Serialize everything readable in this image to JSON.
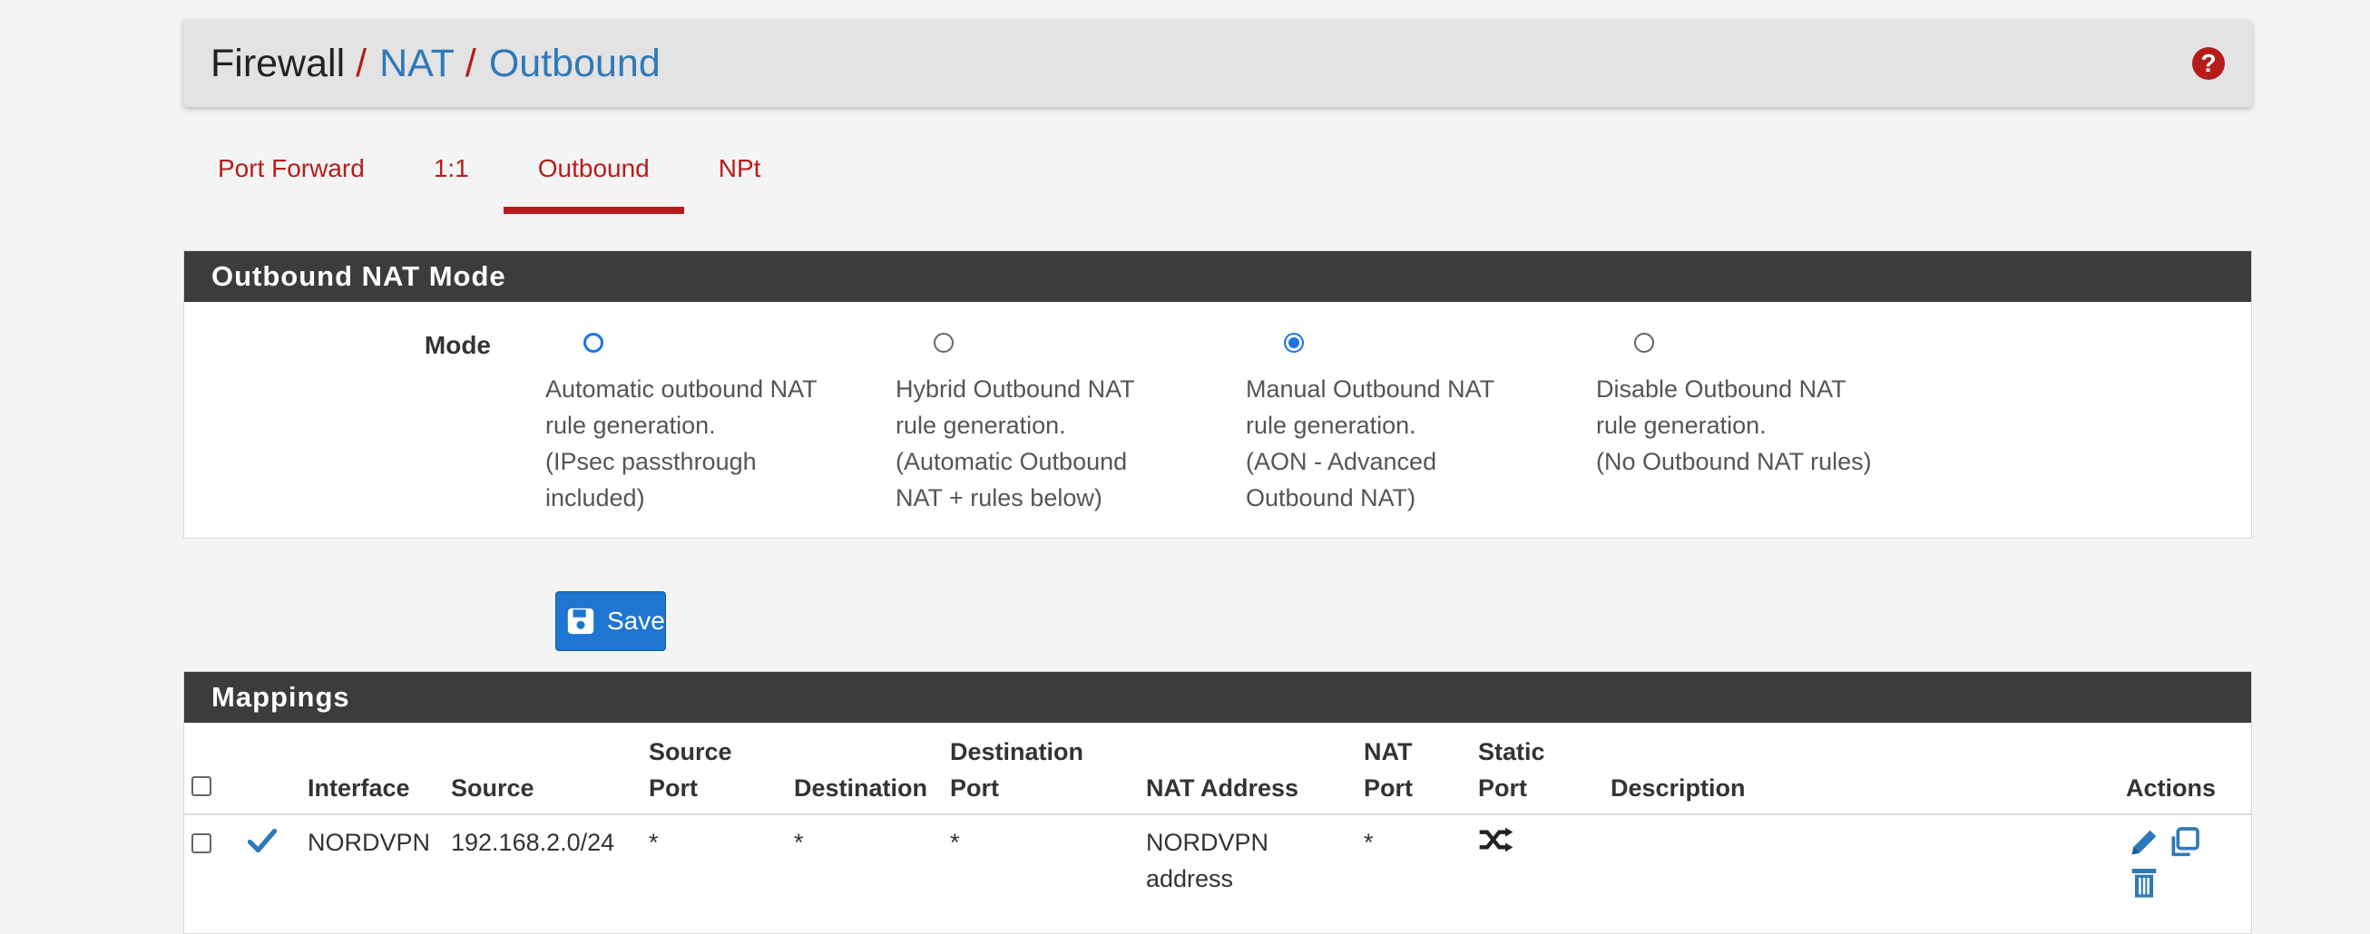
{
  "breadcrumb": {
    "first": "Firewall",
    "second": "NAT",
    "third": "Outbound",
    "sep": "/"
  },
  "help_icon": "question-circle-icon",
  "tabs": [
    {
      "label": "Port Forward"
    },
    {
      "label": "1:1"
    },
    {
      "label": "Outbound",
      "active": true
    },
    {
      "label": "NPt"
    }
  ],
  "mode_panel": {
    "title": "Outbound NAT Mode",
    "label": "Mode",
    "options": [
      {
        "line1": "Automatic outbound NAT",
        "line2": "rule generation.",
        "line3": "(IPsec passthrough",
        "line4": "included)"
      },
      {
        "line1": "Hybrid Outbound NAT",
        "line2": "rule generation.",
        "line3": "(Automatic Outbound",
        "line4": "NAT + rules below)"
      },
      {
        "line1": "Manual Outbound NAT",
        "line2": "rule generation.",
        "line3": "(AON - Advanced",
        "line4": "Outbound NAT)",
        "checked": true
      },
      {
        "line1": "Disable Outbound NAT",
        "line2": "rule generation.",
        "line3": "(No Outbound NAT rules)",
        "line4": ""
      }
    ]
  },
  "save_button": {
    "label": "Save",
    "icon": "floppy-disk-icon"
  },
  "mappings": {
    "title": "Mappings",
    "headers": {
      "interface": "Interface",
      "source": "Source",
      "source_port_1": "Source",
      "source_port_2": "Port",
      "destination": "Destination",
      "dest_port_1": "Destination",
      "dest_port_2": "Port",
      "nat_address": "NAT Address",
      "nat_port_1": "NAT",
      "nat_port_2": "Port",
      "static_port_1": "Static",
      "static_port_2": "Port",
      "description": "Description",
      "actions": "Actions"
    },
    "rows": [
      {
        "interface": "NORDVPN",
        "source": "192.168.2.0/24",
        "source_port": "*",
        "destination": "*",
        "dest_port": "*",
        "nat_address_1": "NORDVPN",
        "nat_address_2": "address",
        "nat_port": "*",
        "static_port_icon": "shuffle-icon",
        "description": ""
      }
    ]
  },
  "colors": {
    "accent_red": "#b71c1c",
    "link_blue": "#2f79b9",
    "button_blue": "#1e76d2",
    "panel_head": "#3c3c3c"
  }
}
